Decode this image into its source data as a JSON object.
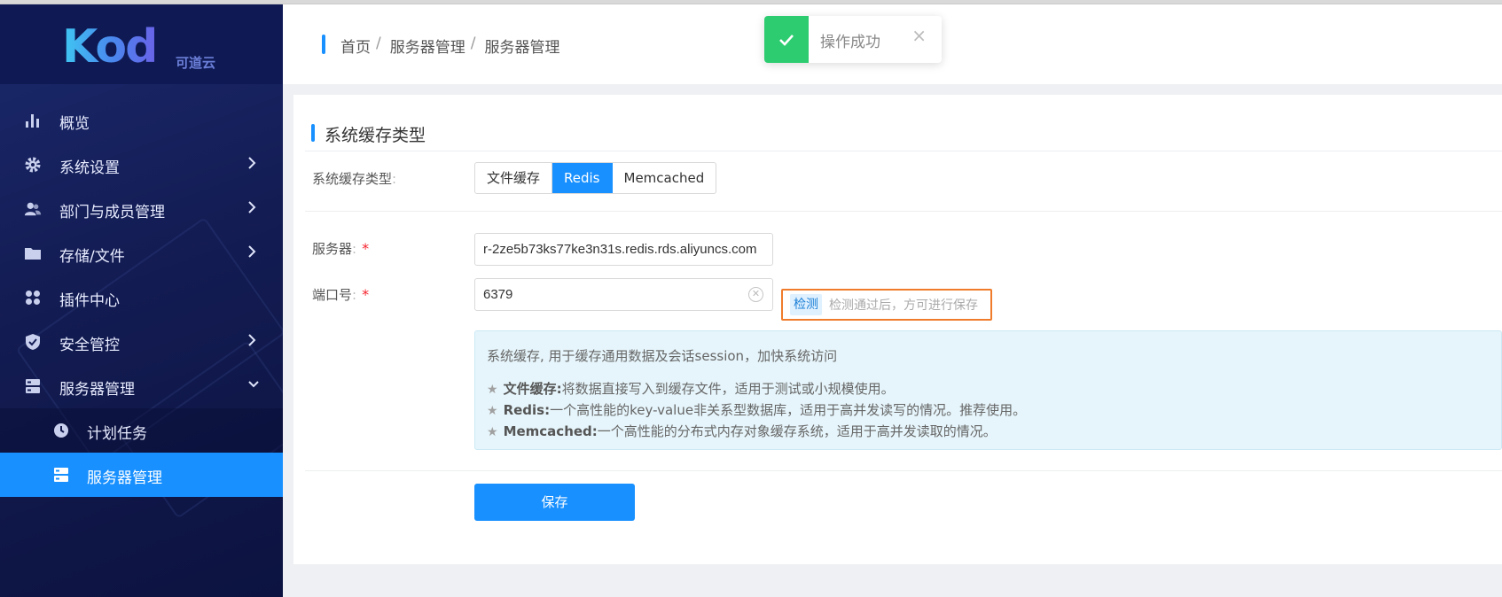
{
  "logo": {
    "text": "Kod",
    "subtitle": "可道云"
  },
  "sidebar": {
    "items": [
      {
        "label": "概览",
        "icon": "bar-chart-icon"
      },
      {
        "label": "系统设置",
        "icon": "gear-icon"
      },
      {
        "label": "部门与成员管理",
        "icon": "users-icon"
      },
      {
        "label": "存储/文件",
        "icon": "folder-icon"
      },
      {
        "label": "插件中心",
        "icon": "grid-icon"
      },
      {
        "label": "安全管控",
        "icon": "shield-icon"
      },
      {
        "label": "服务器管理",
        "icon": "server-icon"
      }
    ],
    "subitems": [
      {
        "label": "计划任务",
        "icon": "clock-icon"
      },
      {
        "label": "服务器管理",
        "icon": "server-icon"
      }
    ]
  },
  "breadcrumb": {
    "home": "首页",
    "parent": "服务器管理",
    "current": "服务器管理",
    "sep": "/"
  },
  "toast": {
    "message": "操作成功",
    "close": "×"
  },
  "section": {
    "title": "系统缓存类型"
  },
  "form": {
    "cache_type_label": "系统缓存类型",
    "cache_options": [
      "文件缓存",
      "Redis",
      "Memcached"
    ],
    "selected_option": "Redis",
    "server_label": "服务器",
    "server_value": "r-2ze5b73ks77ke3n31s.redis.rds.aliyuncs.com",
    "port_label": "端口号",
    "port_value": "6379",
    "required_mark": "*",
    "check_button": "检测",
    "check_tip": "检测通过后，方可进行保存",
    "save_button": "保存"
  },
  "info": {
    "head": "系统缓存, 用于缓存通用数据及会话session，加快系统访问",
    "lines": [
      {
        "name": "文件缓存:",
        "desc": "将数据直接写入到缓存文件，适用于测试或小规模使用。"
      },
      {
        "name": "Redis:",
        "desc": "一个高性能的key-value非关系型数据库，适用于高并发读写的情况。推荐使用。"
      },
      {
        "name": "Memcached:",
        "desc": "一个高性能的分布式内存对象缓存系统，适用于高并发读取的情况。"
      }
    ]
  },
  "colors": {
    "primary": "#1890ff",
    "success": "#2ecc71",
    "sidebar": "#141d55",
    "highlight": "#f07c2b"
  }
}
